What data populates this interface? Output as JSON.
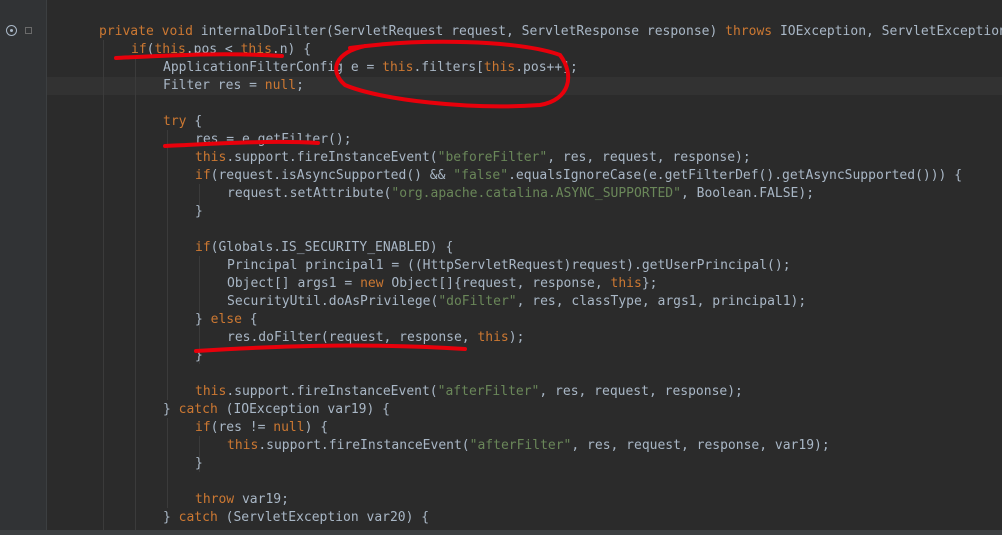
{
  "gutter": {
    "override_icon": "override-method-icon",
    "fold_icon": "fold-marker-icon"
  },
  "colors": {
    "background": "#2b2b2b",
    "keyword": "#cc7832",
    "string": "#6a8759",
    "text": "#a9b7c6",
    "annotation": "#e8000b"
  },
  "code_lines": [
    {
      "indent": 1,
      "tokens": [
        {
          "t": "private void ",
          "k": "kw"
        },
        {
          "t": "internalDoFilter(ServletRequest request, ServletResponse response) ",
          "k": "id"
        },
        {
          "t": "throws ",
          "k": "kw"
        },
        {
          "t": "IOException, ServletException {",
          "k": "id"
        }
      ]
    },
    {
      "indent": 2,
      "tokens": [
        {
          "t": "if",
          "k": "kw"
        },
        {
          "t": "(",
          "k": "id"
        },
        {
          "t": "this",
          "k": "kw"
        },
        {
          "t": ".pos < ",
          "k": "id"
        },
        {
          "t": "this",
          "k": "kw"
        },
        {
          "t": ".n) {",
          "k": "id"
        }
      ]
    },
    {
      "indent": 3,
      "tokens": [
        {
          "t": "ApplicationFilterConfig e = ",
          "k": "id"
        },
        {
          "t": "this",
          "k": "kw"
        },
        {
          "t": ".filters[",
          "k": "id"
        },
        {
          "t": "this",
          "k": "kw"
        },
        {
          "t": ".pos++];",
          "k": "id"
        }
      ]
    },
    {
      "indent": 3,
      "tokens": [
        {
          "t": "Filter res = ",
          "k": "id"
        },
        {
          "t": "null",
          "k": "kw"
        },
        {
          "t": ";",
          "k": "id"
        }
      ]
    },
    {
      "indent": 0,
      "tokens": []
    },
    {
      "indent": 3,
      "tokens": [
        {
          "t": "try ",
          "k": "kw"
        },
        {
          "t": "{",
          "k": "id"
        }
      ]
    },
    {
      "indent": 4,
      "tokens": [
        {
          "t": "res = e.getFilter();",
          "k": "id"
        }
      ]
    },
    {
      "indent": 4,
      "tokens": [
        {
          "t": "this",
          "k": "kw"
        },
        {
          "t": ".support.fireInstanceEvent(",
          "k": "id"
        },
        {
          "t": "\"beforeFilter\"",
          "k": "str"
        },
        {
          "t": ", res, request, response);",
          "k": "id"
        }
      ]
    },
    {
      "indent": 4,
      "tokens": [
        {
          "t": "if",
          "k": "kw"
        },
        {
          "t": "(request.isAsyncSupported() && ",
          "k": "id"
        },
        {
          "t": "\"false\"",
          "k": "str"
        },
        {
          "t": ".equalsIgnoreCase(e.getFilterDef().getAsyncSupported())) {",
          "k": "id"
        }
      ]
    },
    {
      "indent": 5,
      "tokens": [
        {
          "t": "request.setAttribute(",
          "k": "id"
        },
        {
          "t": "\"org.apache.catalina.ASYNC_SUPPORTED\"",
          "k": "str"
        },
        {
          "t": ", Boolean.FALSE);",
          "k": "id"
        }
      ]
    },
    {
      "indent": 4,
      "tokens": [
        {
          "t": "}",
          "k": "id"
        }
      ]
    },
    {
      "indent": 0,
      "tokens": []
    },
    {
      "indent": 4,
      "tokens": [
        {
          "t": "if",
          "k": "kw"
        },
        {
          "t": "(Globals.IS_SECURITY_ENABLED) {",
          "k": "id"
        }
      ]
    },
    {
      "indent": 5,
      "tokens": [
        {
          "t": "Principal principal1 = ((HttpServletRequest)request).getUserPrincipal();",
          "k": "id"
        }
      ]
    },
    {
      "indent": 5,
      "tokens": [
        {
          "t": "Object[] args1 = ",
          "k": "id"
        },
        {
          "t": "new ",
          "k": "kw"
        },
        {
          "t": "Object[]{request, response, ",
          "k": "id"
        },
        {
          "t": "this",
          "k": "kw"
        },
        {
          "t": "};",
          "k": "id"
        }
      ]
    },
    {
      "indent": 5,
      "tokens": [
        {
          "t": "SecurityUtil.doAsPrivilege(",
          "k": "id"
        },
        {
          "t": "\"doFilter\"",
          "k": "str"
        },
        {
          "t": ", res, classType, args1, principal1);",
          "k": "id"
        }
      ]
    },
    {
      "indent": 4,
      "tokens": [
        {
          "t": "} ",
          "k": "id"
        },
        {
          "t": "else ",
          "k": "kw"
        },
        {
          "t": "{",
          "k": "id"
        }
      ]
    },
    {
      "indent": 5,
      "tokens": [
        {
          "t": "res.doFilter(request, response, ",
          "k": "id"
        },
        {
          "t": "this",
          "k": "kw"
        },
        {
          "t": ");",
          "k": "id"
        }
      ]
    },
    {
      "indent": 4,
      "tokens": [
        {
          "t": "}",
          "k": "id"
        }
      ]
    },
    {
      "indent": 0,
      "tokens": []
    },
    {
      "indent": 4,
      "tokens": [
        {
          "t": "this",
          "k": "kw"
        },
        {
          "t": ".support.fireInstanceEvent(",
          "k": "id"
        },
        {
          "t": "\"afterFilter\"",
          "k": "str"
        },
        {
          "t": ", res, request, response);",
          "k": "id"
        }
      ]
    },
    {
      "indent": 3,
      "tokens": [
        {
          "t": "} ",
          "k": "id"
        },
        {
          "t": "catch ",
          "k": "kw"
        },
        {
          "t": "(IOException var19) {",
          "k": "id"
        }
      ]
    },
    {
      "indent": 4,
      "tokens": [
        {
          "t": "if",
          "k": "kw"
        },
        {
          "t": "(res != ",
          "k": "id"
        },
        {
          "t": "null",
          "k": "kw"
        },
        {
          "t": ") {",
          "k": "id"
        }
      ]
    },
    {
      "indent": 5,
      "tokens": [
        {
          "t": "this",
          "k": "kw"
        },
        {
          "t": ".support.fireInstanceEvent(",
          "k": "id"
        },
        {
          "t": "\"afterFilter\"",
          "k": "str"
        },
        {
          "t": ", res, request, response, var19);",
          "k": "id"
        }
      ]
    },
    {
      "indent": 4,
      "tokens": [
        {
          "t": "}",
          "k": "id"
        }
      ]
    },
    {
      "indent": 0,
      "tokens": []
    },
    {
      "indent": 4,
      "tokens": [
        {
          "t": "throw ",
          "k": "kw"
        },
        {
          "t": "var19;",
          "k": "id"
        }
      ]
    },
    {
      "indent": 3,
      "tokens": [
        {
          "t": "} ",
          "k": "id"
        },
        {
          "t": "catch ",
          "k": "kw"
        },
        {
          "t": "(ServletException var20) {",
          "k": "id"
        }
      ]
    }
  ]
}
